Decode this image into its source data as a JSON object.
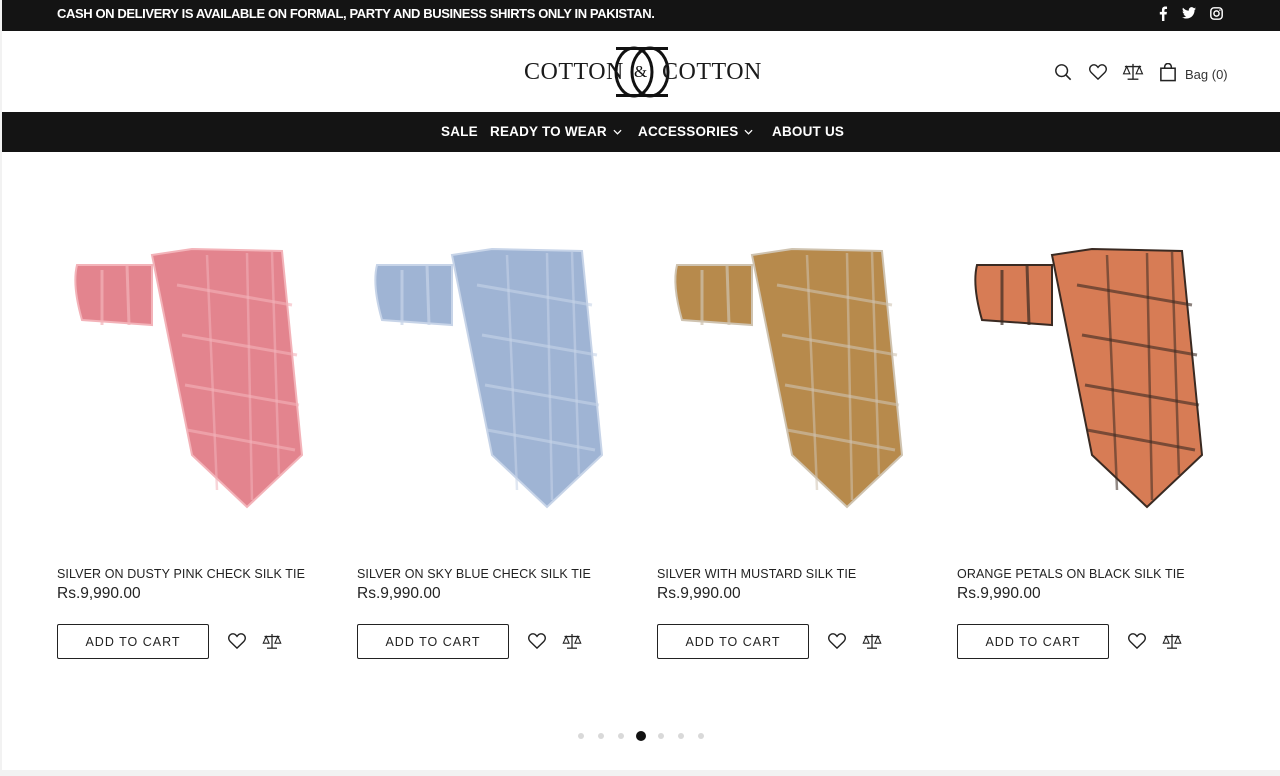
{
  "announcement": {
    "text": "CASH ON DELIVERY IS AVAILABLE ON FORMAL, PARTY AND BUSINESS SHIRTS ONLY IN PAKISTAN."
  },
  "social": [
    "facebook-icon",
    "twitter-icon",
    "instagram-icon"
  ],
  "brand": {
    "left": "COTTON",
    "right": "COTTON",
    "amp": "&"
  },
  "header": {
    "bag_label": "Bag (0)",
    "icons": [
      "search-icon",
      "heart-icon",
      "compare-icon",
      "bag-icon"
    ]
  },
  "nav": [
    {
      "label": "SALE",
      "dropdown": false
    },
    {
      "label": "READY TO WEAR",
      "dropdown": true
    },
    {
      "label": "ACCESSORIES",
      "dropdown": true
    },
    {
      "label": "ABOUT US",
      "dropdown": false
    }
  ],
  "products": [
    {
      "name": "SILVER ON DUSTY PINK CHECK SILK TIE",
      "price": "Rs.9,990.00",
      "cta": "ADD TO CART",
      "color": "#e3848e",
      "accent": "#f3b3b9"
    },
    {
      "name": "SILVER ON SKY BLUE CHECK SILK TIE",
      "price": "Rs.9,990.00",
      "cta": "ADD TO CART",
      "color": "#9fb4d4",
      "accent": "#c7d4e8"
    },
    {
      "name": "SILVER WITH MUSTARD SILK TIE",
      "price": "Rs.9,990.00",
      "cta": "ADD TO CART",
      "color": "#b78a4c",
      "accent": "#cfc3b0"
    },
    {
      "name": "ORANGE PETALS ON BLACK SILK TIE",
      "price": "Rs.9,990.00",
      "cta": "ADD TO CART",
      "color": "#d77c55",
      "accent": "#3a2a22"
    }
  ],
  "carousel": {
    "total": 7,
    "active": 4
  }
}
